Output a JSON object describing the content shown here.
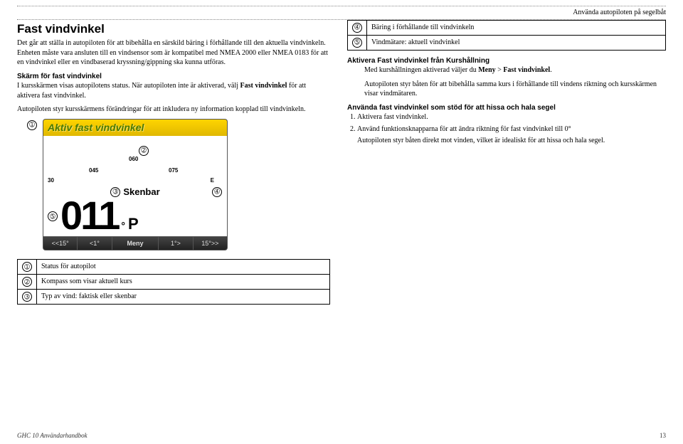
{
  "header_right": "Använda autopiloten på segelbåt",
  "left": {
    "h1": "Fast vindvinkel",
    "p1": "Det går att ställa in autopiloten för att bibehålla en särskild bäring i förhållande till den aktuella vindvinkeln. Enheten måste vara ansluten till en vindsensor som är kompatibel med NMEA 2000 eller NMEA 0183 för att en vindvinkel eller en vindbaserad kryssning/gippning ska kunna utföras.",
    "sub1": "Skärm för fast vindvinkel",
    "p2a": "I kursskärmen visas autopilotens status. När autopiloten inte är aktiverad, välj ",
    "p2b": "Fast vindvinkel",
    "p2c": " för att aktivera fast vindvinkel.",
    "p3": "Autopiloten styr kursskärmens förändringar för att inkludera ny information kopplad till vindvinkeln.",
    "device": {
      "title": "Aktiv fast vindvinkel",
      "g045": "045",
      "g060": "060",
      "g075": "075",
      "g30": "30",
      "gE": "E",
      "wind_type": "Skenbar",
      "big": "011",
      "deg": "°",
      "p": "P",
      "btn1": "<<15°",
      "btn2": "<1°",
      "btn3": "Meny",
      "btn4": "1°>",
      "btn5": "15°>>"
    },
    "markers": {
      "m1": "➀",
      "m2": "➁",
      "m3": "➂",
      "m4": "➃",
      "m5": "➄"
    },
    "table2": [
      {
        "n": "➀",
        "t": "Status för autopilot"
      },
      {
        "n": "➁",
        "t": "Kompass som visar aktuell kurs"
      },
      {
        "n": "➂",
        "t": "Typ av vind: faktisk eller skenbar"
      }
    ]
  },
  "right": {
    "table1": [
      {
        "n": "➃",
        "t": "Bäring i förhållande till vindvinkeln"
      },
      {
        "n": "➄",
        "t": "Vindmätare: aktuell vindvinkel"
      }
    ],
    "sub2": "Aktivera Fast vindvinkel från Kurshållning",
    "p4a": "Med kurshållningen aktiverad väljer du ",
    "p4b": "Meny",
    "p4c": " > ",
    "p4d": "Fast vindvinkel",
    "p4e": ".",
    "p5": "Autopiloten styr båten för att bibehålla samma kurs i förhållande till vindens riktning och kursskärmen visar vindmätaren.",
    "sub3": "Använda fast vindvinkel som stöd för att hissa och hala segel",
    "li1": "Aktivera fast vindvinkel.",
    "li2": "Använd funktionsknapparna för att ändra riktning för fast vindvinkel till 0°",
    "li2p": "Autopiloten styr båten direkt mot vinden, vilket är idealiskt för att hissa och hala segel."
  },
  "footer_left": "GHC 10 Användarhandbok",
  "footer_right": "13"
}
